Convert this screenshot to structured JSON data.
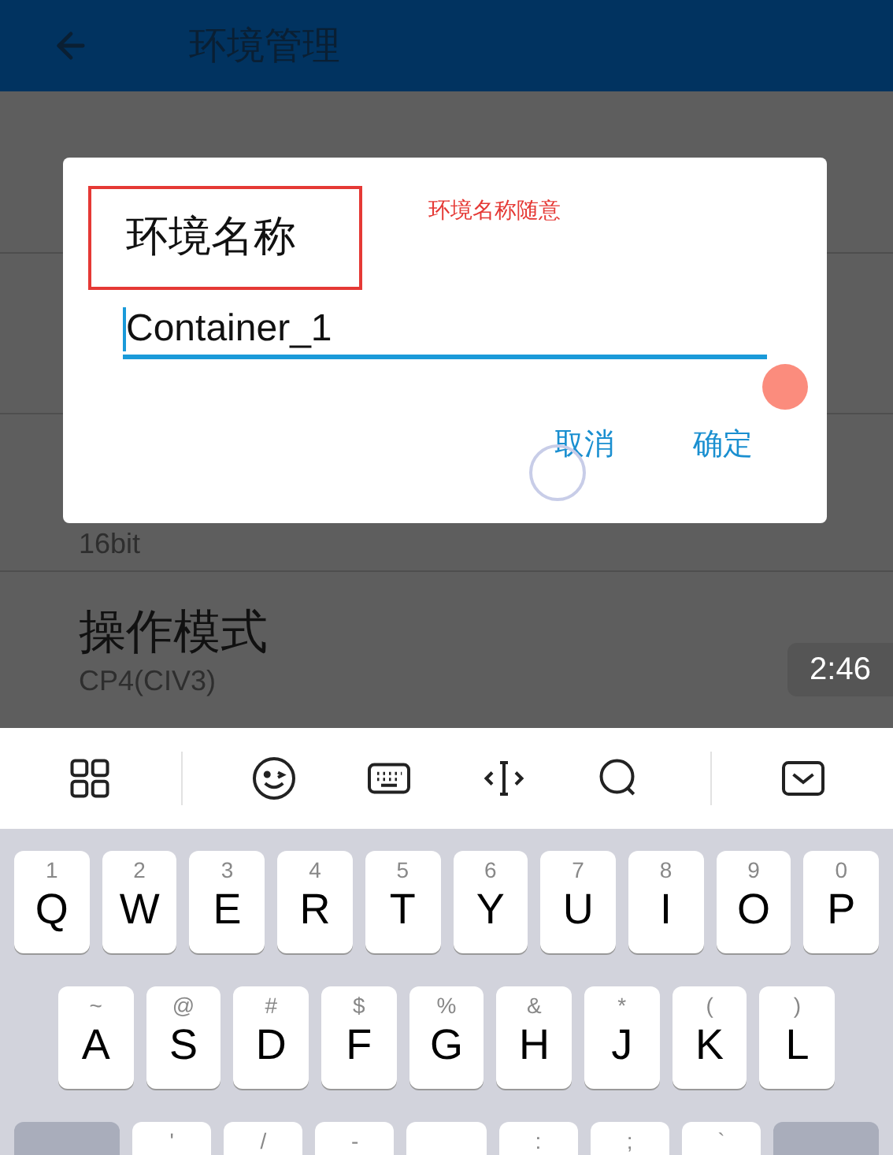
{
  "app_bar": {
    "title": "环境管理"
  },
  "settings_list": [
    {
      "subtitle": "16bit"
    },
    {
      "title": "操作模式",
      "subtitle": "CP4(CIV3)"
    }
  ],
  "dialog": {
    "title": "环境名称",
    "annotation": "环境名称随意",
    "input_value": "Container_1",
    "buttons": [
      "取消",
      "确定"
    ]
  },
  "video_time": "2:46",
  "keyboard": {
    "rows": [
      [
        {
          "kind": "letter",
          "hint": "1",
          "key": "Q"
        },
        {
          "kind": "letter",
          "hint": "2",
          "key": "W"
        },
        {
          "kind": "letter",
          "hint": "3",
          "key": "E"
        },
        {
          "kind": "letter",
          "hint": "4",
          "key": "R"
        },
        {
          "kind": "letter",
          "hint": "5",
          "key": "T"
        },
        {
          "kind": "letter",
          "hint": "6",
          "key": "Y"
        },
        {
          "kind": "letter",
          "hint": "7",
          "key": "U"
        },
        {
          "kind": "letter",
          "hint": "8",
          "key": "I"
        },
        {
          "kind": "letter",
          "hint": "9",
          "key": "O"
        },
        {
          "kind": "letter",
          "hint": "0",
          "key": "P"
        }
      ],
      [
        {
          "kind": "letter",
          "hint": "~",
          "key": "A"
        },
        {
          "kind": "letter",
          "hint": "@",
          "key": "S"
        },
        {
          "kind": "letter",
          "hint": "#",
          "key": "D"
        },
        {
          "kind": "letter",
          "hint": "$",
          "key": "F"
        },
        {
          "kind": "letter",
          "hint": "%",
          "key": "G"
        },
        {
          "kind": "letter",
          "hint": "&",
          "key": "H"
        },
        {
          "kind": "letter",
          "hint": "*",
          "key": "J"
        },
        {
          "kind": "letter",
          "hint": "(",
          "key": "K"
        },
        {
          "kind": "letter",
          "hint": ")",
          "key": "L"
        }
      ],
      [
        {
          "kind": "shift"
        },
        {
          "kind": "letter",
          "hint": "'"
        },
        {
          "kind": "letter",
          "hint": "/"
        },
        {
          "kind": "letter",
          "hint": "-"
        },
        {
          "kind": "letter"
        },
        {
          "kind": "letter",
          "hint": ":"
        },
        {
          "kind": "letter",
          "hint": ";"
        },
        {
          "kind": "letter",
          "hint": "`"
        },
        {
          "kind": "function"
        }
      ]
    ]
  }
}
